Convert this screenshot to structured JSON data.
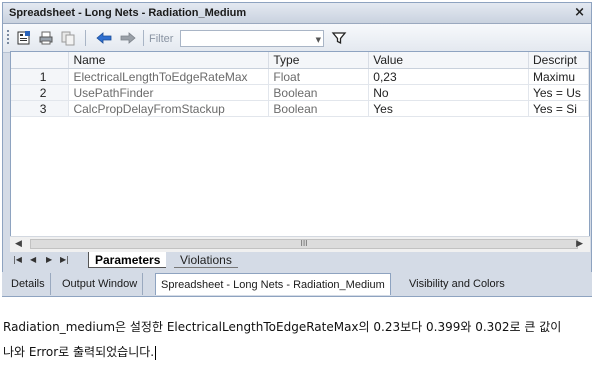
{
  "window": {
    "title": "Spreadsheet - Long Nets - Radiation_Medium",
    "close_label": "×"
  },
  "toolbar": {
    "filter_label": "Filter",
    "filter_value": ""
  },
  "grid": {
    "columns": [
      "Name",
      "Type",
      "Value",
      "Descript"
    ],
    "rows": [
      {
        "num": "1",
        "name": "ElectricalLengthToEdgeRateMax",
        "type": "Float",
        "value": "0,23",
        "desc": "Maximu"
      },
      {
        "num": "2",
        "name": "UsePathFinder",
        "type": "Boolean",
        "value": "No",
        "desc": "Yes = Us"
      },
      {
        "num": "3",
        "name": "CalcPropDelayFromStackup",
        "type": "Boolean",
        "value": "Yes",
        "desc": "Yes = Si"
      }
    ],
    "scroll_grip": "III"
  },
  "sheet_tabs": {
    "active": "Parameters",
    "inactive": "Violations"
  },
  "bottom_tabs": [
    "Details",
    "Output Window",
    "Spreadsheet - Long Nets - Radiation_Medium",
    "Visibility and Colors"
  ],
  "caption": {
    "line1": "Radiation_medium은 설정한 ElectricalLengthToEdgeRateMax의 0.23보다 0.399와 0.302로 큰 값이",
    "line2": "나와 Error로 출력되었습니다."
  },
  "colors": {
    "panel_bg": "#d4dbe6",
    "border": "#8ea3c0"
  }
}
